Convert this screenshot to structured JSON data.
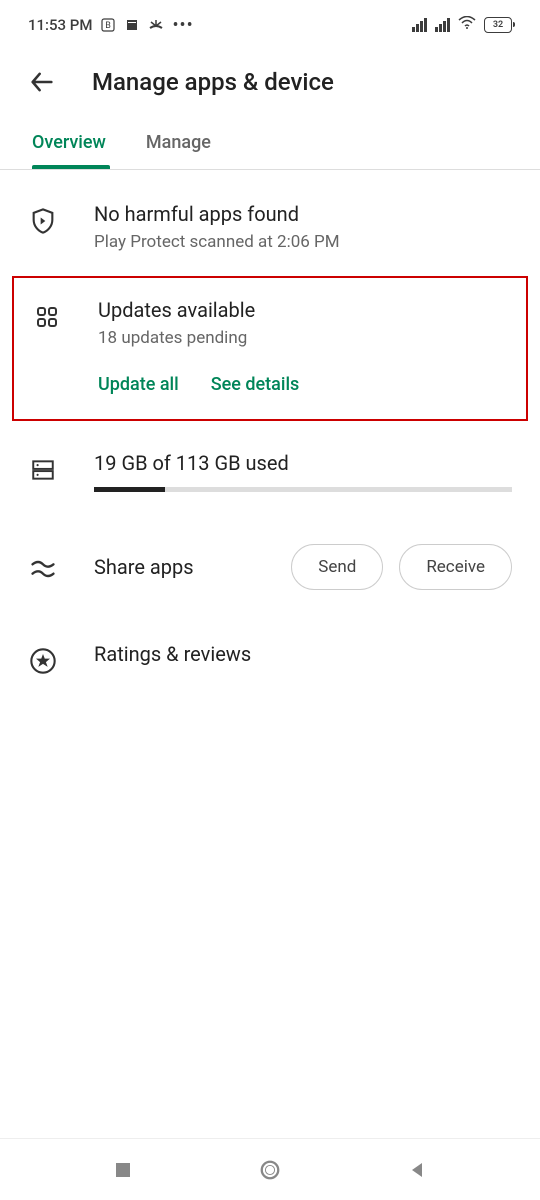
{
  "status_bar": {
    "time": "11:53 PM",
    "battery_percent": "32"
  },
  "header": {
    "title": "Manage apps & device"
  },
  "tabs": {
    "overview": "Overview",
    "manage": "Manage"
  },
  "protect": {
    "title": "No harmful apps found",
    "subtitle": "Play Protect scanned at 2:06 PM"
  },
  "updates": {
    "title": "Updates available",
    "subtitle": "18 updates pending",
    "update_all": "Update all",
    "see_details": "See details"
  },
  "storage": {
    "title": "19 GB of 113 GB used",
    "used_percent": 17
  },
  "share": {
    "title": "Share apps",
    "send": "Send",
    "receive": "Receive"
  },
  "ratings": {
    "title": "Ratings & reviews"
  }
}
